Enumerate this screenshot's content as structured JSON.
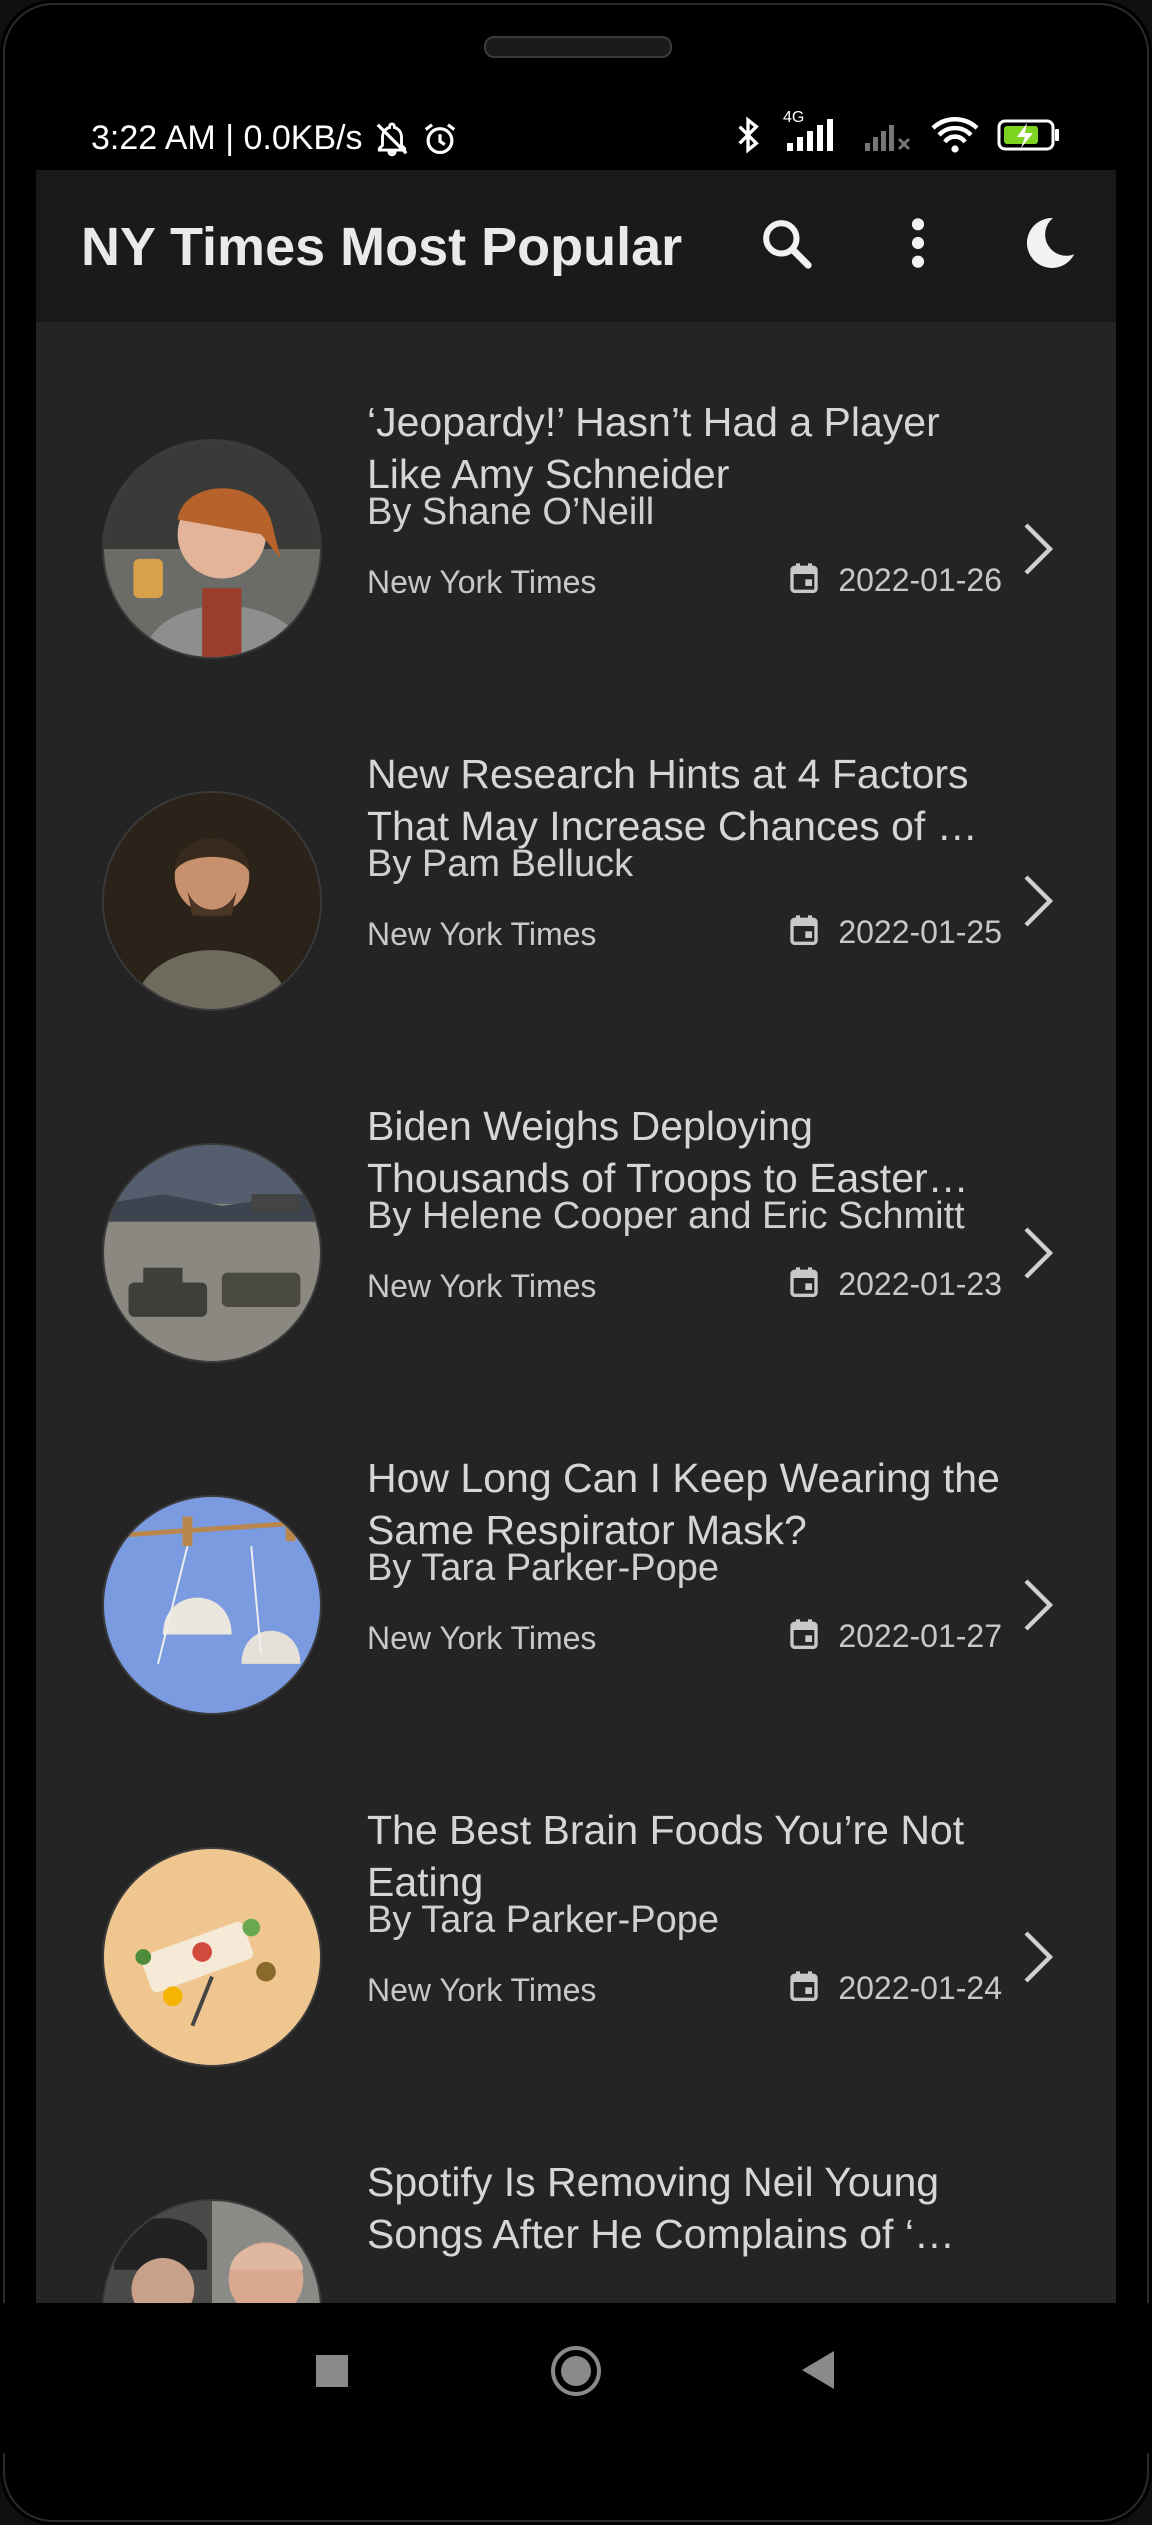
{
  "status_bar": {
    "time_text": "3:22 AM | 0.0KB/s",
    "network_type": "4G",
    "icons": [
      "bell-off-icon",
      "alarm-icon",
      "bluetooth-icon",
      "signal-icon",
      "wifi-icon",
      "battery-charging-icon"
    ]
  },
  "app_bar": {
    "title": "NY Times Most Popular",
    "actions": [
      "search-icon",
      "more-vert-icon",
      "dark-mode-moon-icon"
    ]
  },
  "articles": [
    {
      "title": "‘Jeopardy!’ Hasn’t Had a Player Like Amy Schneider",
      "byline": "By Shane O’Neill",
      "source": "New York Times",
      "date": "2022-01-26"
    },
    {
      "title": "New Research Hints at 4 Factors That May Increase Chances of …",
      "byline": "By Pam Belluck",
      "source": "New York Times",
      "date": "2022-01-25"
    },
    {
      "title": "Biden Weighs Deploying Thousands of Troops to Easter…",
      "byline": "By Helene Cooper and Eric Schmitt",
      "source": "New York Times",
      "date": "2022-01-23"
    },
    {
      "title": "How Long Can I Keep Wearing the Same Respirator Mask?",
      "byline": "By Tara Parker-Pope",
      "source": "New York Times",
      "date": "2022-01-27"
    },
    {
      "title": "The Best Brain Foods You’re Not Eating",
      "byline": "By Tara Parker-Pope",
      "source": "New York Times",
      "date": "2022-01-24"
    },
    {
      "title": "Spotify Is Removing Neil Young Songs After He Complains of ‘…",
      "byline": "",
      "source": "",
      "date": ""
    }
  ],
  "nav_bar": {
    "buttons": [
      "recents-square-icon",
      "home-circle-icon",
      "back-triangle-icon"
    ]
  },
  "colors": {
    "background": "#242424",
    "app_bar": "#1a1a1a",
    "text_primary": "#d6d6d6",
    "accent_battery": "#7ed321"
  }
}
